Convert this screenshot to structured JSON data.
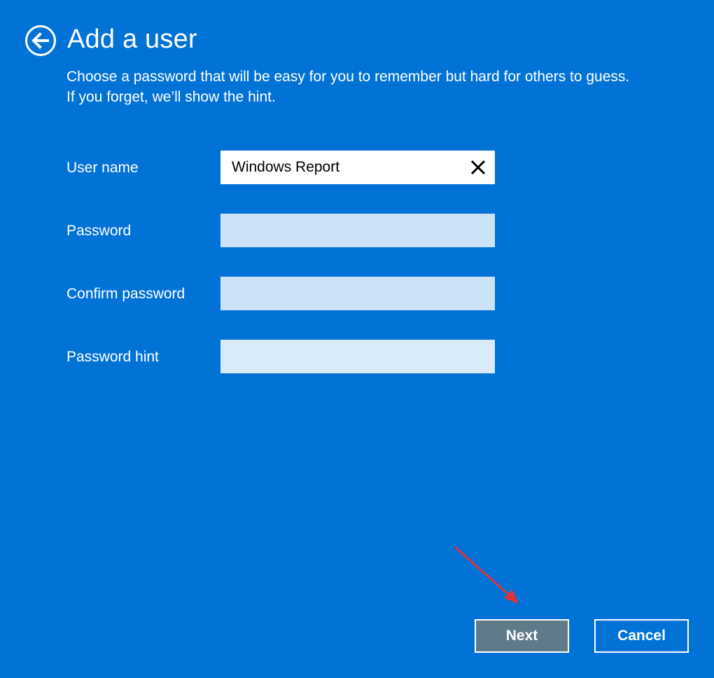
{
  "header": {
    "back_icon": "back-arrow-circle-icon",
    "title": "Add a user"
  },
  "instructions": {
    "line1": "Choose a password that will be easy for you to remember but hard for others to guess.",
    "line2": "If you forget, we’ll show the hint."
  },
  "form": {
    "username": {
      "label": "User name",
      "value": "Windows Report",
      "clear_icon": "close-icon"
    },
    "password": {
      "label": "Password",
      "value": ""
    },
    "confirm_password": {
      "label": "Confirm password",
      "value": ""
    },
    "password_hint": {
      "label": "Password hint",
      "value": ""
    }
  },
  "actions": {
    "next_label": "Next",
    "cancel_label": "Cancel"
  },
  "colors": {
    "background": "#0173d7",
    "field_fill": "#cce2f7",
    "next_button": "#5f7a89",
    "annotation_arrow": "#e0323c"
  }
}
